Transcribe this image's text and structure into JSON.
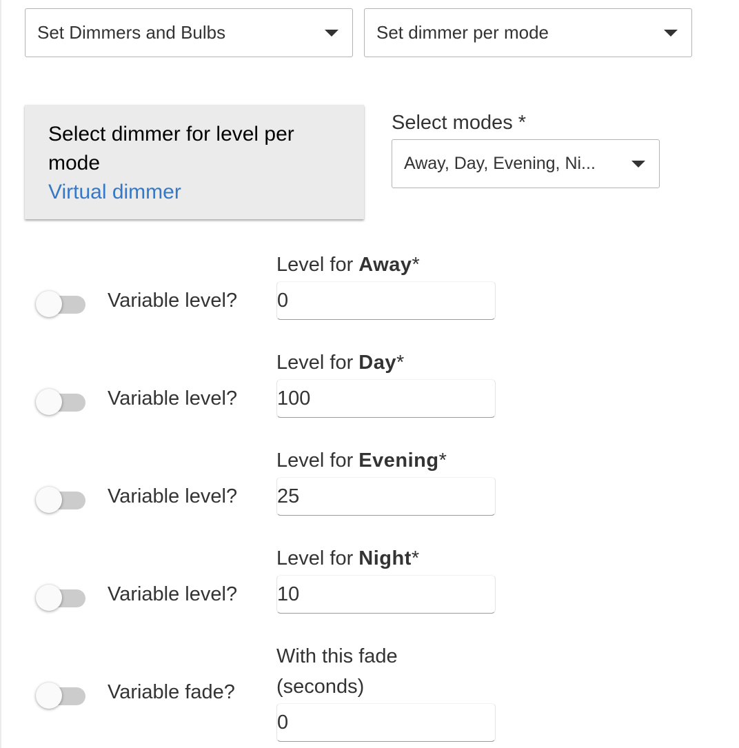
{
  "top_selects": {
    "category": {
      "value": "Set Dimmers and Bulbs"
    },
    "action": {
      "value": "Set dimmer per mode"
    }
  },
  "dimmer_card": {
    "title": "Select dimmer for level per mode",
    "value": "Virtual dimmer"
  },
  "modes_select": {
    "label": "Select modes *",
    "value": "Away, Day, Evening, Ni..."
  },
  "mode_rows": [
    {
      "toggle_label": "Variable level?",
      "toggle_on": false,
      "label_prefix": "Level for ",
      "mode": "Away",
      "required_mark": "*",
      "value": "0"
    },
    {
      "toggle_label": "Variable level?",
      "toggle_on": false,
      "label_prefix": "Level for ",
      "mode": "Day",
      "required_mark": "*",
      "value": "100"
    },
    {
      "toggle_label": "Variable level?",
      "toggle_on": false,
      "label_prefix": "Level for ",
      "mode": "Evening",
      "required_mark": "*",
      "value": "25"
    },
    {
      "toggle_label": "Variable level?",
      "toggle_on": false,
      "label_prefix": "Level for ",
      "mode": "Night",
      "required_mark": "*",
      "value": "10"
    }
  ],
  "fade_row": {
    "toggle_label": "Variable fade?",
    "toggle_on": false,
    "label_line1": "With this fade",
    "label_line2": "(seconds)",
    "value": "0"
  },
  "colors": {
    "link_blue": "#3478c6",
    "card_background": "#ebebeb",
    "toggle_track_off": "#cccccc"
  }
}
